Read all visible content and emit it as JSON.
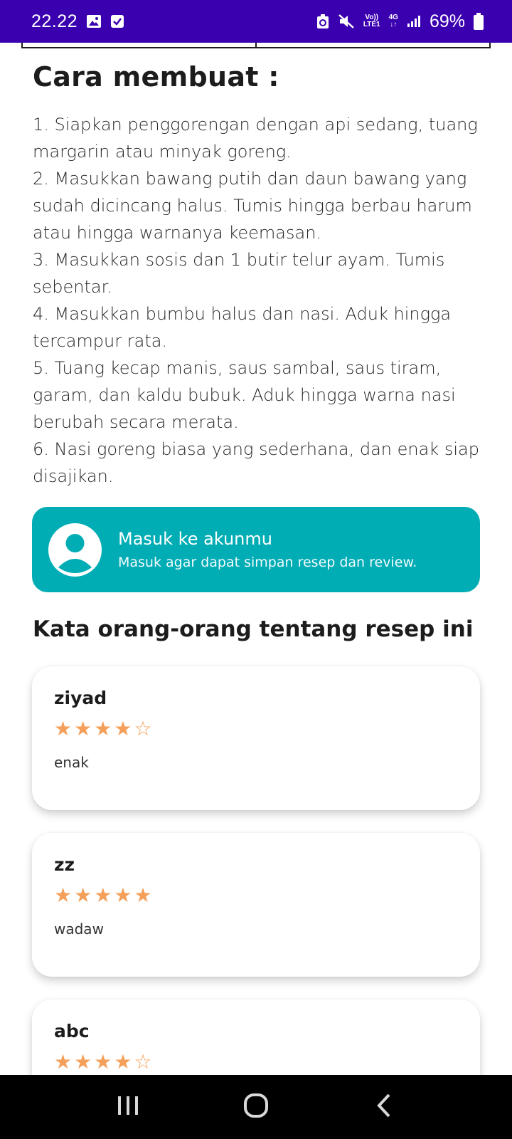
{
  "status_bar": {
    "time": "22.22",
    "network": {
      "volte": "Vo))",
      "lte": "LTE1",
      "gen": "4G"
    },
    "battery": "69%"
  },
  "recipe": {
    "section_title": "Cara membuat :",
    "steps": [
      "1. Siapkan penggorengan dengan api sedang, tuang margarin atau minyak goreng.",
      "2. Masukkan bawang putih dan daun bawang yang sudah dicincang halus. Tumis hingga berbau harum atau hingga warnanya keemasan.",
      "3. Masukkan sosis dan 1 butir telur ayam. Tumis sebentar.",
      "4. Masukkan bumbu halus dan nasi. Aduk hingga tercampur rata.",
      "5. Tuang kecap manis, saus sambal, saus tiram, garam, dan kaldu bubuk. Aduk hingga warna nasi berubah secara merata.",
      "6. Nasi goreng biasa yang sederhana, dan enak siap disajikan."
    ]
  },
  "login_card": {
    "title": "Masuk ke akunmu",
    "subtitle": "Masuk agar dapat simpan resep dan review.",
    "background": "#00adb5"
  },
  "reviews": {
    "title": "Kata orang-orang tentang resep ini",
    "max_rating": 5,
    "star_color": "#f5a05a",
    "items": [
      {
        "name": "ziyad",
        "rating": 4,
        "text": "enak"
      },
      {
        "name": "zz",
        "rating": 5,
        "text": "wadaw"
      },
      {
        "name": "abc",
        "rating": 4,
        "text": ""
      }
    ]
  },
  "colors": {
    "status_bar": "#3a00b0",
    "text": "#1c1c1c"
  },
  "icons": {
    "status_left": [
      "gallery-icon",
      "checkbox-icon"
    ],
    "status_right": [
      "data-saver-icon",
      "mute-icon",
      "signal-icon",
      "battery-icon"
    ],
    "nav": [
      "recent-apps-icon",
      "home-icon",
      "back-icon"
    ]
  }
}
